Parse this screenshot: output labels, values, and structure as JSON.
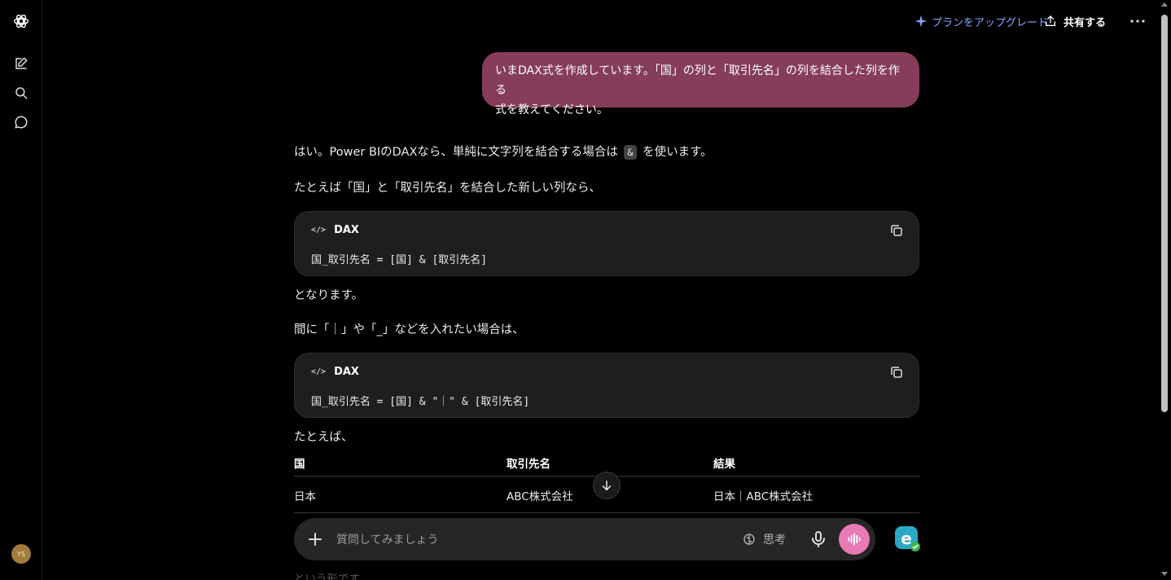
{
  "header": {
    "upgrade_label": "プランをアップグレード",
    "share_label": "共有する"
  },
  "sidebar": {
    "avatar_initials": "YS"
  },
  "conversation": {
    "user_message_line1": "いまDAX式を作成しています。「国」の列と「取引先名」の列を結合した列を作る",
    "user_message_line2": "式を教えてください。",
    "p1_before": "はい。Power BIのDAXなら、単純に文字列を結合する場合は",
    "p1_code": "&",
    "p1_after": "を使います。",
    "p2": "たとえば「国」と「取引先名」を結合した新しい列なら、",
    "code1_lang": "DAX",
    "code1_text": "国_取引先名 = [国] & [取引先名]",
    "p3": "となります。",
    "p4": "間に「｜」や「_」などを入れたい場合は、",
    "code2_lang": "DAX",
    "code2_text": "国_取引先名 = [国] & \"｜\" & [取引先名]",
    "p5": "たとえば、",
    "table": {
      "headers": [
        "国",
        "取引先名",
        "結果"
      ],
      "row1": [
        "日本",
        "ABC株式会社",
        "日本｜ABC株式会社"
      ]
    },
    "faded_text": "という形です"
  },
  "composer": {
    "placeholder": "質問してみましょう",
    "think_label": "思考"
  },
  "colors": {
    "user_bubble": "#853d5b",
    "accent_link": "#7fa6ff",
    "voice_button": "#e97ab4"
  }
}
